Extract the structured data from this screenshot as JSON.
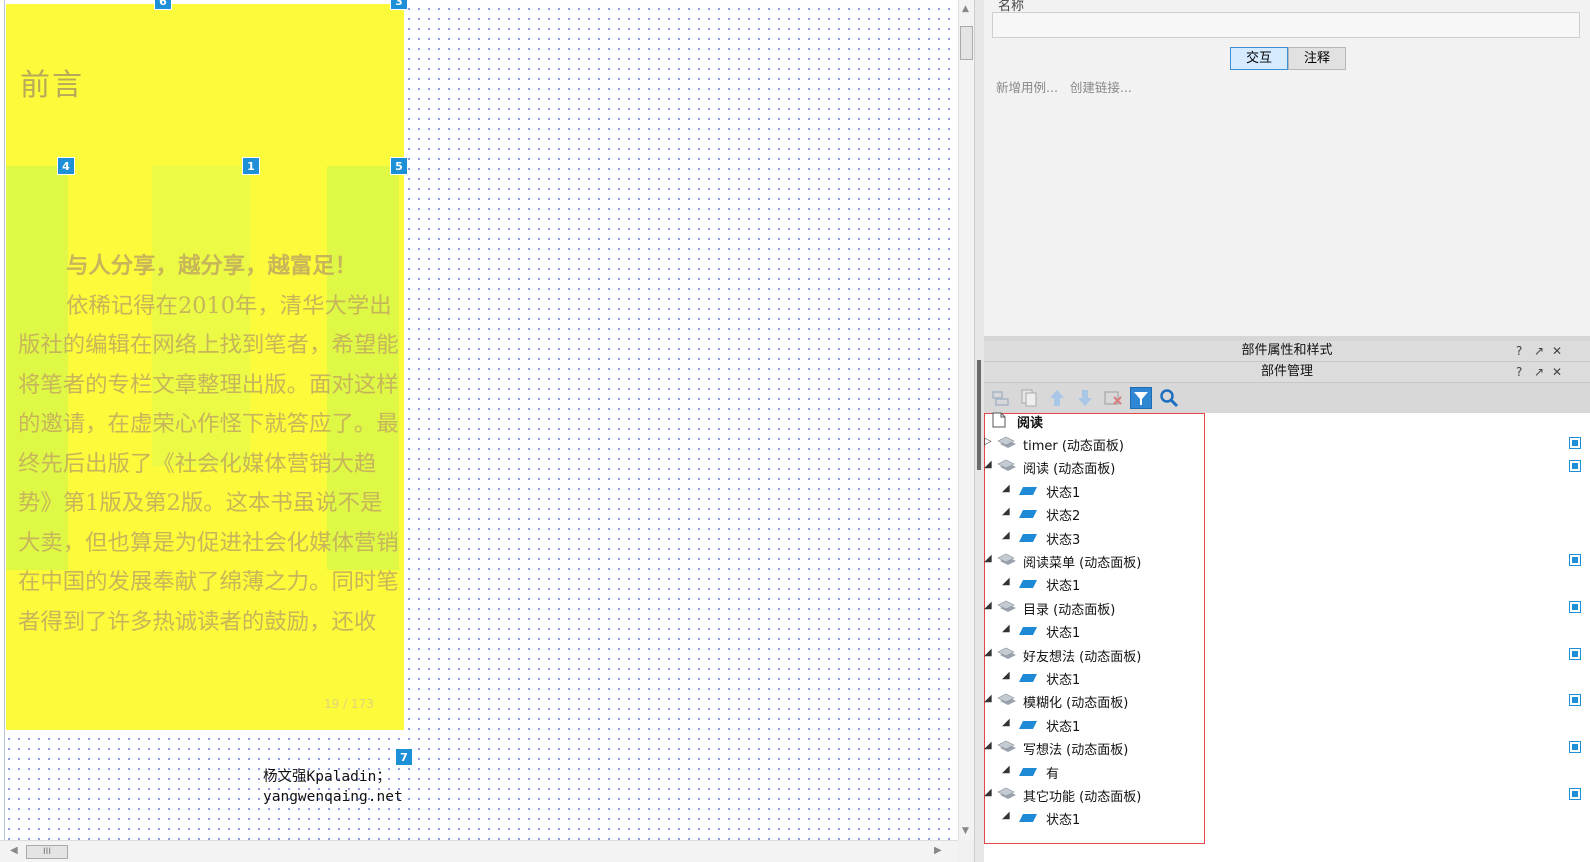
{
  "canvas": {
    "preface_title": "前言",
    "page_number": "19 / 173",
    "paragraphs": [
      "与人分享，越分享，越富足！",
      "依稀记得在2010年，清华大学出版社的编辑在网络上找到笔者，希望能将笔者的专栏文章整理出版。面对这样的邀请，在虚荣心作怪下就答应了。最终先后出版了《社会化媒体营销大趋势》第1版及第2版。这本书虽说不是大卖，但也算是为促进社会化媒体营销在中国的发展奉献了绵薄之力。同时笔者得到了许多热诚读者的鼓励，还收"
    ],
    "markers": [
      "6",
      "3",
      "4",
      "1",
      "5",
      "7"
    ],
    "author_name": "杨文强Kpaladin；",
    "author_site": "yangwenqaing.net",
    "hscroll_grip": "III"
  },
  "properties": {
    "name_label": "名称",
    "name_value": "",
    "tabs": [
      "交互",
      "注释"
    ],
    "active_tab": "交互",
    "links": [
      "新增用例...",
      "创建链接..."
    ]
  },
  "panels": {
    "properties_title": "部件属性和样式",
    "manager_title": "部件管理",
    "help": "?",
    "popout": "↗",
    "close": "✕"
  },
  "toolbar": {
    "buttons": [
      "add-folder-icon",
      "duplicate-icon",
      "move-up-icon",
      "move-down-icon",
      "delete-icon",
      "filter-icon",
      "search-icon"
    ]
  },
  "tree": {
    "root": "阅读",
    "items": [
      {
        "label": "timer (动态面板)",
        "level": 1,
        "expanded": false
      },
      {
        "label": "阅读 (动态面板)",
        "level": 1,
        "expanded": true
      },
      {
        "label": "状态1",
        "level": 2
      },
      {
        "label": "状态2",
        "level": 2
      },
      {
        "label": "状态3",
        "level": 2
      },
      {
        "label": "阅读菜单 (动态面板)",
        "level": 1,
        "expanded": true
      },
      {
        "label": "状态1",
        "level": 2
      },
      {
        "label": "目录 (动态面板)",
        "level": 1,
        "expanded": true
      },
      {
        "label": "状态1",
        "level": 2
      },
      {
        "label": "好友想法 (动态面板)",
        "level": 1,
        "expanded": true
      },
      {
        "label": "状态1",
        "level": 2
      },
      {
        "label": "模糊化 (动态面板)",
        "level": 1,
        "expanded": true
      },
      {
        "label": "状态1",
        "level": 2
      },
      {
        "label": "写想法 (动态面板)",
        "level": 1,
        "expanded": true
      },
      {
        "label": "有",
        "level": 2
      },
      {
        "label": "其它功能 (动态面板)",
        "level": 1,
        "expanded": true
      },
      {
        "label": "状态1",
        "level": 2
      }
    ]
  },
  "colors": {
    "accent": "#1e90d8",
    "highlight_yellow": "#fbfb3b",
    "selection_border": "#e0464b"
  }
}
